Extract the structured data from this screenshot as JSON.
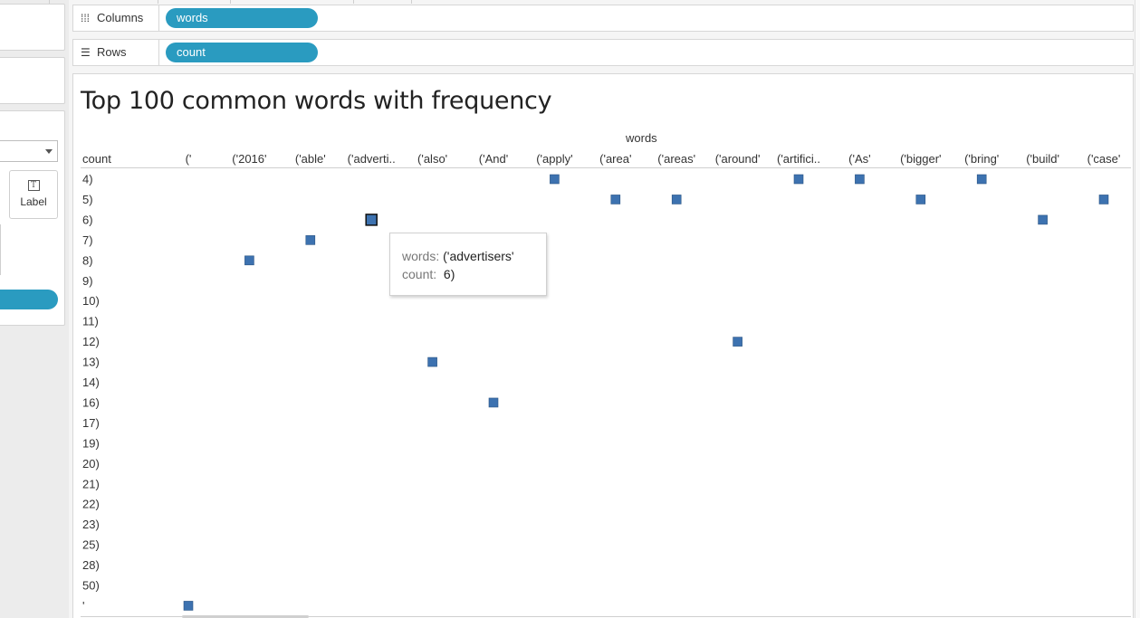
{
  "shelves": {
    "columns": {
      "label": "Columns",
      "pill": "words"
    },
    "rows": {
      "label": "Rows",
      "pill": "count"
    }
  },
  "left_panel": {
    "label_button": "Label"
  },
  "icons": {
    "columns_shelf": "columns-icon",
    "rows_shelf": "rows-icon",
    "label_button": "text-label-icon",
    "dropdown": "chevron-down-icon"
  },
  "colors": {
    "accent_pill": "#2a9bc0",
    "mark": "#3d72b0",
    "mark_border": "#2a5483"
  },
  "tooltip": {
    "words_key": "words:",
    "words_value": "('advertisers'",
    "count_key": "count:",
    "count_value": "6)"
  },
  "chart_data": {
    "type": "scatter",
    "title": "Top 100 common words with frequency",
    "xlabel": "words",
    "ylabel": "count",
    "x_categories": [
      "('",
      "('2016'",
      "('able'",
      "('adverti..",
      "('also'",
      "('And'",
      "('apply'",
      "('area'",
      "('areas'",
      "('around'",
      "('artifici..",
      "('As'",
      "('bigger'",
      "('bring'",
      "('build'",
      "('case'"
    ],
    "y_categories": [
      "4)",
      "5)",
      "6)",
      "7)",
      "8)",
      "9)",
      "10)",
      "11)",
      "12)",
      "13)",
      "14)",
      "16)",
      "17)",
      "19)",
      "20)",
      "21)",
      "22)",
      "23)",
      "25)",
      "28)",
      "50)",
      "'"
    ],
    "points": [
      {
        "x": "('",
        "y": "'"
      },
      {
        "x": "('2016'",
        "y": "8)"
      },
      {
        "x": "('able'",
        "y": "7)"
      },
      {
        "x": "('adverti..",
        "y": "6)",
        "highlighted": true
      },
      {
        "x": "('also'",
        "y": "13)"
      },
      {
        "x": "('And'",
        "y": "16)"
      },
      {
        "x": "('apply'",
        "y": "4)"
      },
      {
        "x": "('area'",
        "y": "5)"
      },
      {
        "x": "('areas'",
        "y": "5)"
      },
      {
        "x": "('around'",
        "y": "12)"
      },
      {
        "x": "('artifici..",
        "y": "4)"
      },
      {
        "x": "('As'",
        "y": "4)"
      },
      {
        "x": "('bigger'",
        "y": "5)"
      },
      {
        "x": "('bring'",
        "y": "4)"
      },
      {
        "x": "('build'",
        "y": "6)"
      },
      {
        "x": "('case'",
        "y": "5)"
      }
    ],
    "legend": "none",
    "grid": false
  }
}
